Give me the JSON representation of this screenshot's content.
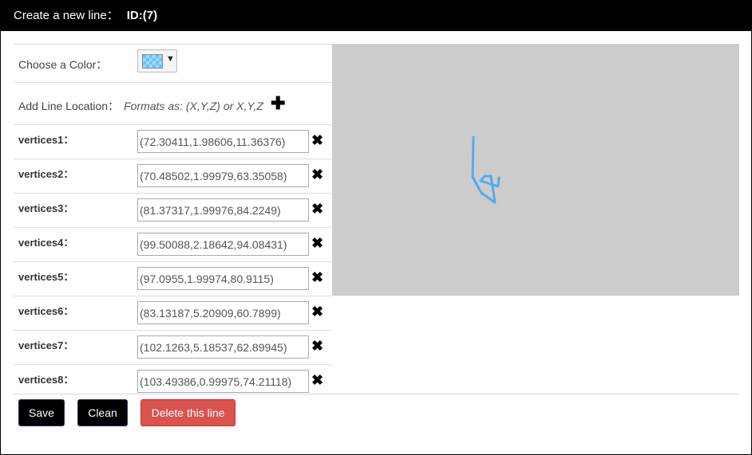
{
  "dialog": {
    "title": "Create a new line：",
    "id_label": "ID:(7)"
  },
  "form": {
    "color_label": "Choose a Color：",
    "color_value": "#55aaee",
    "color_caret": "▼",
    "location_label": "Add Line Location：",
    "location_hint": "Formats as: (X,Y,Z) or X,Y,Z",
    "add_icon": "plus-icon",
    "delete_icon": "close-icon",
    "vertices": [
      {
        "label": "vertices1：",
        "value": "(72.30411,1.98606,11.36376)"
      },
      {
        "label": "vertices2：",
        "value": "(70.48502,1.99979,63.35058)"
      },
      {
        "label": "vertices3：",
        "value": "(81.37317,1.99976,84.2249)"
      },
      {
        "label": "vertices4：",
        "value": "(99.50088,2.18642,94.08431)"
      },
      {
        "label": "vertices5：",
        "value": "(97.0955,1.99974,80.9115)"
      },
      {
        "label": "vertices6：",
        "value": "(83.13187,5.20909,60.7899)"
      },
      {
        "label": "vertices7：",
        "value": "(102.1263,5.18537,62.89945)"
      },
      {
        "label": "vertices8：",
        "value": "(103.49386,0.99975,74.21118)"
      }
    ]
  },
  "buttons": {
    "save": "Save",
    "clean": "Clean",
    "delete": "Delete this line"
  },
  "colors": {
    "title_bg": "#000000",
    "preview_bg": "#cccccc",
    "line_color": "#55aaee",
    "delete_button": "#d9534f"
  }
}
